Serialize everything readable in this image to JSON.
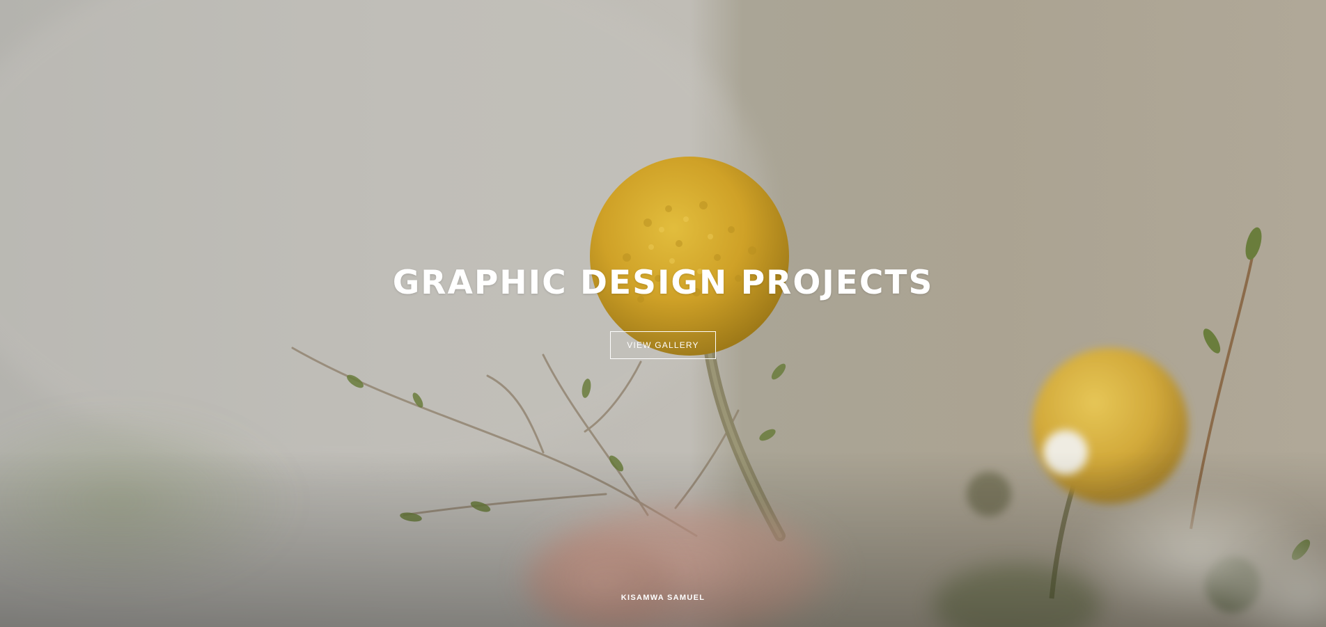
{
  "hero": {
    "title": "GRAPHIC DESIGN PROJECTS",
    "button_label": "VIEW GALLERY",
    "background_image": "yellow-billy-button-flowers-photo"
  },
  "footer": {
    "author": "KISAMWA SAMUEL"
  },
  "colors": {
    "text": "#ffffff",
    "flower_yellow": "#d1a62a",
    "background_left": "#bdbbb5",
    "background_right": "#aba392"
  }
}
